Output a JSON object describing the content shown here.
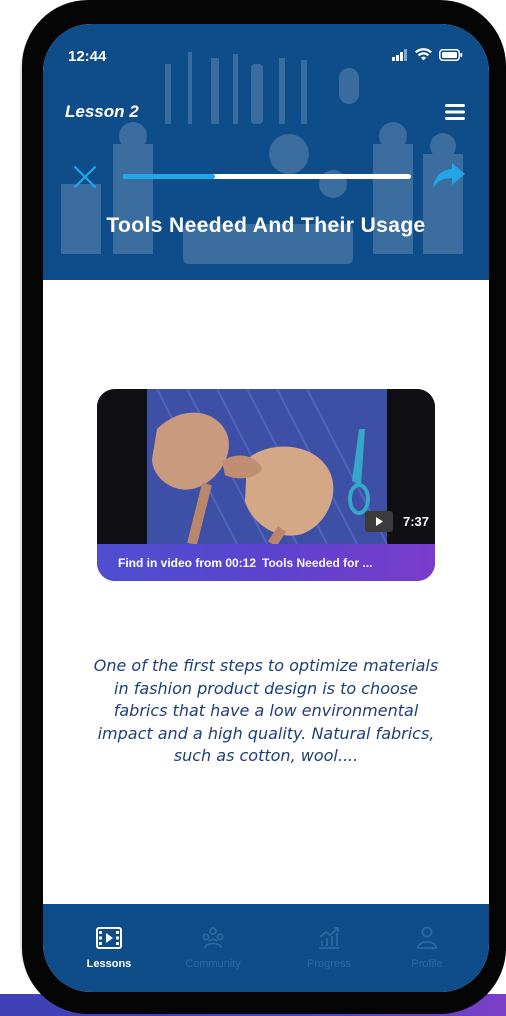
{
  "status_bar": {
    "time": "12:44"
  },
  "header": {
    "lesson_label": "Lesson 2",
    "title": "Tools Needed And Their Usage",
    "progress": 0.32
  },
  "video": {
    "duration": "7:37",
    "find_label": "Find in video from 00:12",
    "video_title": "Tools Needed for ..."
  },
  "description": "One of the first steps to optimize materials in fashion product design is to choose fabrics that have a low environmental impact and a high quality. Natural fabrics, such as cotton, wool....",
  "tabs": [
    {
      "label": "Lessons",
      "icon": "lessons-icon",
      "active": true
    },
    {
      "label": "Community",
      "icon": "community-icon",
      "active": false
    },
    {
      "label": "Progress",
      "icon": "progress-icon",
      "active": false
    },
    {
      "label": "Profile",
      "icon": "profile-icon",
      "active": false
    }
  ],
  "colors": {
    "header_bg": "#0f4d8a",
    "progress_fill": "#23a6e8",
    "description_text": "#1f3f7a",
    "video_bar": "#5b43cf"
  }
}
